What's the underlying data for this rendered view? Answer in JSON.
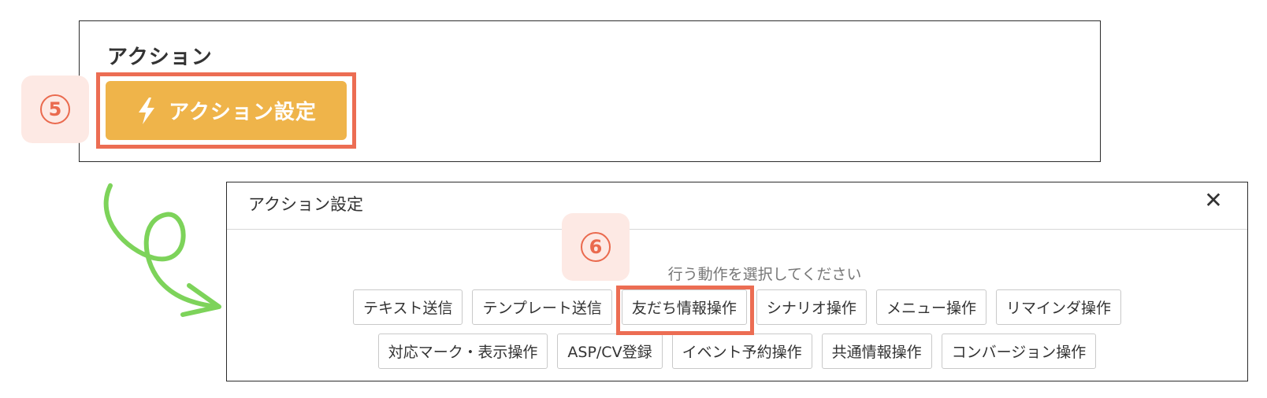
{
  "section": {
    "title": "アクション",
    "action_button_label": "アクション設定",
    "action_button_icon": "lightning-bolt-icon",
    "step_badge": "5"
  },
  "modal": {
    "title": "アクション設定",
    "close_icon": "close-icon",
    "close_glyph": "✕",
    "step_badge": "6",
    "prompt": "行う動作を選択してください",
    "row1": [
      "テキスト送信",
      "テンプレート送信",
      "友だち情報操作",
      "シナリオ操作",
      "メニュー操作",
      "リマインダ操作"
    ],
    "row2": [
      "対応マーク・表示操作",
      "ASP/CV登録",
      "イベント予約操作",
      "共通情報操作",
      "コンバージョン操作"
    ],
    "highlighted_option": "友だち情報操作"
  },
  "colors": {
    "accent_orange": "#efb44a",
    "highlight_red": "#ec6d53",
    "badge_bg": "#fde9e4",
    "arrow_green": "#7dd35a"
  }
}
